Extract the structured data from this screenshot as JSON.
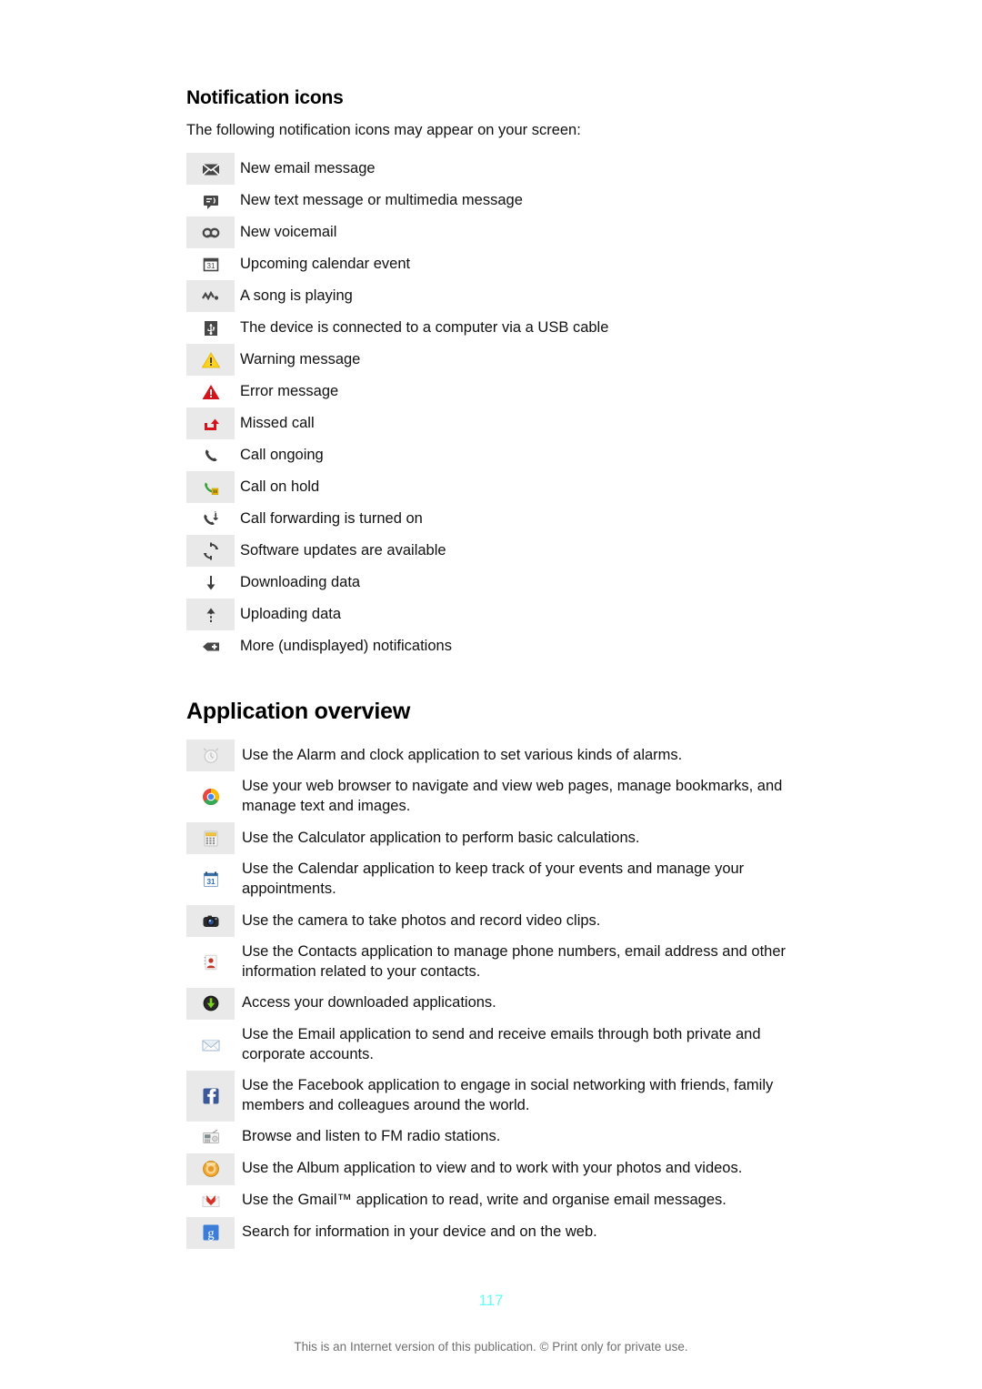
{
  "document": {
    "page_number": "117",
    "disclaimer": "This is an Internet version of this publication. © Print only for private use.",
    "page_number_color": "#5ffff1",
    "row_shade_color": "#e9e9e9"
  },
  "notification_section": {
    "title": "Notification icons",
    "intro": "The following notification icons may appear on your screen:",
    "rows": [
      {
        "icon": "envelope-icon",
        "label": "New email message"
      },
      {
        "icon": "sms-bubble-icon",
        "label": "New text message or multimedia message"
      },
      {
        "icon": "voicemail-icon",
        "label": "New voicemail"
      },
      {
        "icon": "calendar-31-icon",
        "label": "Upcoming calendar event"
      },
      {
        "icon": "music-note-icon",
        "label": "A song is playing"
      },
      {
        "icon": "usb-icon",
        "label": "The device is connected to a computer via a USB cable"
      },
      {
        "icon": "warning-triangle-icon",
        "label": "Warning message"
      },
      {
        "icon": "error-triangle-icon",
        "label": "Error message"
      },
      {
        "icon": "missed-call-icon",
        "label": "Missed call"
      },
      {
        "icon": "call-ongoing-icon",
        "label": "Call ongoing"
      },
      {
        "icon": "call-on-hold-icon",
        "label": "Call on hold"
      },
      {
        "icon": "call-forwarding-icon",
        "label": "Call forwarding is turned on"
      },
      {
        "icon": "software-update-icon",
        "label": "Software updates are available"
      },
      {
        "icon": "download-arrow-icon",
        "label": "Downloading data"
      },
      {
        "icon": "upload-arrow-icon",
        "label": "Uploading data"
      },
      {
        "icon": "more-notifications-icon",
        "label": "More (undisplayed) notifications"
      }
    ]
  },
  "application_section": {
    "title": "Application overview",
    "rows": [
      {
        "icon": "alarm-clock-icon",
        "label": "Use the Alarm and clock application to set various kinds of alarms."
      },
      {
        "icon": "chrome-browser-icon",
        "label": "Use your web browser to navigate and view web pages, manage bookmarks, and manage text and images."
      },
      {
        "icon": "calculator-icon",
        "label": "Use the Calculator application to perform basic calculations."
      },
      {
        "icon": "calendar-app-icon",
        "label": "Use the Calendar application to keep track of your events and manage your appointments."
      },
      {
        "icon": "camera-icon",
        "label": "Use the camera to take photos and record video clips."
      },
      {
        "icon": "contacts-icon",
        "label": "Use the Contacts application to manage phone numbers, email address and other information related to your contacts."
      },
      {
        "icon": "downloads-icon",
        "label": "Access your downloaded applications."
      },
      {
        "icon": "email-icon",
        "label": "Use the Email application to send and receive emails through both private and corporate accounts."
      },
      {
        "icon": "facebook-icon",
        "label": "Use the Facebook application to engage in social networking with friends, family members and colleagues around the world."
      },
      {
        "icon": "fm-radio-icon",
        "label": "Browse and listen to FM radio stations."
      },
      {
        "icon": "album-icon",
        "label": "Use the Album application to view and to work with your photos and videos."
      },
      {
        "icon": "gmail-icon",
        "label": "Use the Gmail™ application to read, write and organise email messages."
      },
      {
        "icon": "google-search-icon",
        "label": "Search for information in your device and on the web."
      }
    ]
  }
}
